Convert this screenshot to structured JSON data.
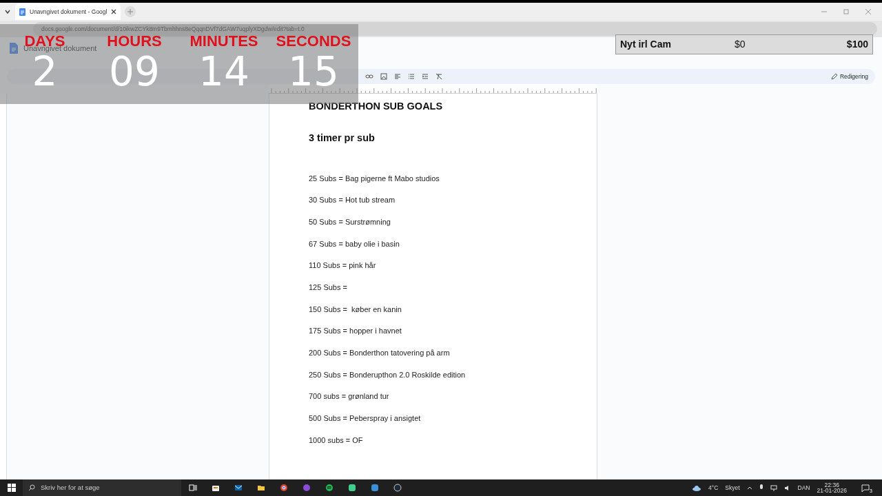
{
  "browser": {
    "tab": {
      "title": "Unavngivet dokument - Googl",
      "selected": true
    },
    "url": "docs.google.com/document/d/10ikwZCYk8m9Tbmhhns8eQqqnDVf7dGAW7uqplyXDgdw/edit?tab=t.0"
  },
  "docs": {
    "title": "Unavngivet dokument",
    "toolbar": {
      "mode": "Redigering"
    }
  },
  "document": {
    "title": "BONDERTHON SUB GOALS",
    "subtitle": "3 timer pr sub",
    "lines": [
      "25 Subs = Bag pigerne ft Mabo studios",
      "30 Subs = Hot tub stream",
      "50 Subs = Surstrømning",
      "67 Subs = baby olie i basin",
      "110 Subs = pink hår",
      "125 Subs = ",
      "150 Subs =  køber en kanin",
      "175 Subs = hopper i havnet",
      "200 Subs = Bonderthon tatovering på arm",
      "250 Subs = Bonderupthon 2.0 Roskilde edition",
      "700 subs = grønland tur",
      "500 Subs = Peberspray i ansigtet",
      "1000 subs = OF"
    ]
  },
  "countdown": [
    {
      "label": "DAYS",
      "value": "2"
    },
    {
      "label": "HOURS",
      "value": "09"
    },
    {
      "label": "MINUTES",
      "value": "14"
    },
    {
      "label": "SECONDS",
      "value": "15"
    }
  ],
  "goal": {
    "name": "Nyt irl Cam",
    "current": "$0",
    "target": "$100"
  },
  "taskbar": {
    "search_placeholder": "Skriv her for at søge",
    "weather": "4°C",
    "weather_text": "Skyet",
    "language": "DAN",
    "time": "22:36",
    "date": "21-01-2026",
    "notifications": "3"
  }
}
